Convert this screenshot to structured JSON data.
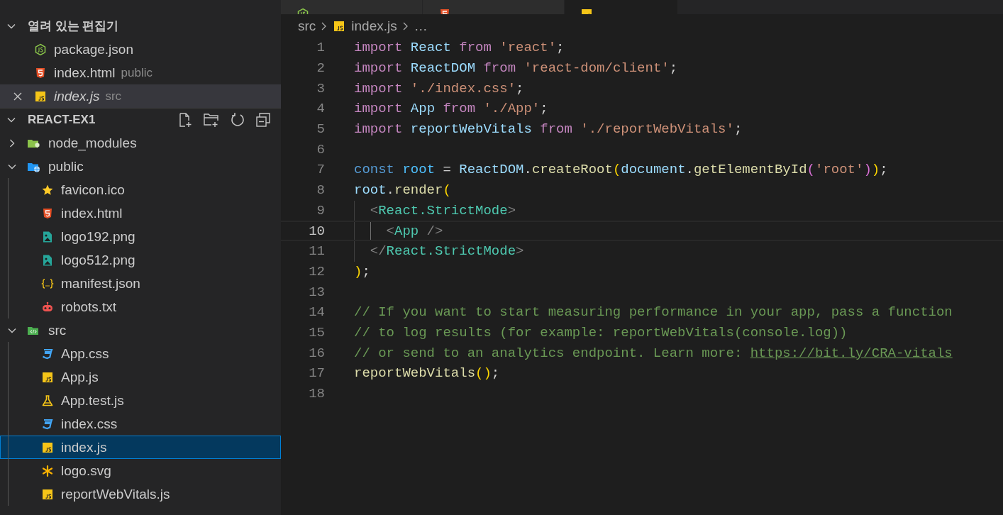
{
  "editor_tabs": [
    {
      "kind": "nodejs",
      "selected": false
    },
    {
      "kind": "html",
      "selected": false
    },
    {
      "kind": "js",
      "selected": true
    }
  ],
  "open_editors": {
    "title": "열려 있는 편집기",
    "expanded": true,
    "items": [
      {
        "name": "package.json",
        "kind": "nodejs",
        "selected": false,
        "preview": false
      },
      {
        "name": "index.html",
        "description": "public",
        "kind": "html",
        "selected": false,
        "preview": false
      },
      {
        "name": "index.js",
        "description": "src",
        "kind": "js",
        "selected": true,
        "preview": true
      }
    ]
  },
  "explorer": {
    "title": "REACT-EX1",
    "expanded": true,
    "tree": [
      {
        "name": "node_modules",
        "kind": "node-folder",
        "expanded": false,
        "selected": false
      },
      {
        "name": "public",
        "kind": "public-folder",
        "expanded": true,
        "selected": false,
        "children": [
          {
            "name": "favicon.ico",
            "kind": "star",
            "selected": false
          },
          {
            "name": "index.html",
            "kind": "html",
            "selected": false
          },
          {
            "name": "logo192.png",
            "kind": "image",
            "selected": false
          },
          {
            "name": "logo512.png",
            "kind": "image",
            "selected": false
          },
          {
            "name": "manifest.json",
            "kind": "braces",
            "selected": false
          },
          {
            "name": "robots.txt",
            "kind": "robot",
            "selected": false
          }
        ]
      },
      {
        "name": "src",
        "kind": "src-folder",
        "expanded": true,
        "selected": false,
        "children": [
          {
            "name": "App.css",
            "kind": "css",
            "selected": false
          },
          {
            "name": "App.js",
            "kind": "js",
            "selected": false
          },
          {
            "name": "App.test.js",
            "kind": "flask",
            "selected": false
          },
          {
            "name": "index.css",
            "kind": "css",
            "selected": false
          },
          {
            "name": "index.js",
            "kind": "js",
            "selected": true
          },
          {
            "name": "logo.svg",
            "kind": "asterisk",
            "selected": false
          },
          {
            "name": "reportWebVitals.js",
            "kind": "js",
            "selected": false
          }
        ]
      }
    ]
  },
  "breadcrumb": [
    {
      "text": "src",
      "kind": "folder"
    },
    {
      "text": "index.js",
      "kind": "js"
    },
    {
      "text": "…",
      "kind": "more"
    }
  ],
  "code": [
    {
      "number": "1",
      "current": false,
      "tokens": [
        {
          "t": "import ",
          "kind": "keyword"
        },
        {
          "t": "React ",
          "kind": "var"
        },
        {
          "t": "from ",
          "kind": "keyword"
        },
        {
          "t": "'react'",
          "kind": "string"
        },
        {
          "t": ";",
          "kind": "plain"
        }
      ]
    },
    {
      "number": "2",
      "current": false,
      "tokens": [
        {
          "t": "import ",
          "kind": "keyword"
        },
        {
          "t": "ReactDOM ",
          "kind": "var"
        },
        {
          "t": "from ",
          "kind": "keyword"
        },
        {
          "t": "'react-dom/client'",
          "kind": "string"
        },
        {
          "t": ";",
          "kind": "plain"
        }
      ]
    },
    {
      "number": "3",
      "current": false,
      "tokens": [
        {
          "t": "import ",
          "kind": "keyword"
        },
        {
          "t": "'./index.css'",
          "kind": "string"
        },
        {
          "t": ";",
          "kind": "plain"
        }
      ]
    },
    {
      "number": "4",
      "current": false,
      "tokens": [
        {
          "t": "import ",
          "kind": "keyword"
        },
        {
          "t": "App ",
          "kind": "var"
        },
        {
          "t": "from ",
          "kind": "keyword"
        },
        {
          "t": "'./App'",
          "kind": "string"
        },
        {
          "t": ";",
          "kind": "plain"
        }
      ]
    },
    {
      "number": "5",
      "current": false,
      "tokens": [
        {
          "t": "import ",
          "kind": "keyword"
        },
        {
          "t": "reportWebVitals ",
          "kind": "var"
        },
        {
          "t": "from ",
          "kind": "keyword"
        },
        {
          "t": "'./reportWebVitals'",
          "kind": "string"
        },
        {
          "t": ";",
          "kind": "plain"
        }
      ]
    },
    {
      "number": "6",
      "current": false
    },
    {
      "number": "7",
      "current": false,
      "tokens": [
        {
          "t": "const ",
          "kind": "storage"
        },
        {
          "t": "root ",
          "kind": "const"
        },
        {
          "t": "= ",
          "kind": "plain"
        },
        {
          "t": "ReactDOM",
          "kind": "var"
        },
        {
          "t": ".",
          "kind": "plain"
        },
        {
          "t": "createRoot",
          "kind": "func"
        },
        {
          "t": "(",
          "kind": "paren1"
        },
        {
          "t": "document",
          "kind": "var"
        },
        {
          "t": ".",
          "kind": "plain"
        },
        {
          "t": "getElementById",
          "kind": "func"
        },
        {
          "t": "(",
          "kind": "paren2"
        },
        {
          "t": "'root'",
          "kind": "string"
        },
        {
          "t": ")",
          "kind": "paren2"
        },
        {
          "t": ")",
          "kind": "paren1"
        },
        {
          "t": ";",
          "kind": "plain"
        }
      ]
    },
    {
      "number": "8",
      "current": false,
      "tokens": [
        {
          "t": "root",
          "kind": "var"
        },
        {
          "t": ".",
          "kind": "plain"
        },
        {
          "t": "render",
          "kind": "func"
        },
        {
          "t": "(",
          "kind": "paren1"
        }
      ]
    },
    {
      "number": "9",
      "current": false,
      "guides": [
        {
          "active": false
        }
      ],
      "tokens": [
        {
          "t": "<",
          "kind": "angle"
        },
        {
          "t": "React.StrictMode",
          "kind": "tag"
        },
        {
          "t": ">",
          "kind": "angle"
        }
      ]
    },
    {
      "number": "10",
      "current": true,
      "guides": [
        {
          "active": false
        },
        {
          "active": true
        }
      ],
      "tokens": [
        {
          "t": "<",
          "kind": "angle"
        },
        {
          "t": "App ",
          "kind": "tag"
        },
        {
          "t": "/>",
          "kind": "angle"
        }
      ]
    },
    {
      "number": "11",
      "current": false,
      "guides": [
        {
          "active": false
        }
      ],
      "tokens": [
        {
          "t": "</",
          "kind": "angle"
        },
        {
          "t": "React.StrictMode",
          "kind": "tag"
        },
        {
          "t": ">",
          "kind": "angle"
        }
      ]
    },
    {
      "number": "12",
      "current": false,
      "tokens": [
        {
          "t": ")",
          "kind": "paren1"
        },
        {
          "t": ";",
          "kind": "plain"
        }
      ]
    },
    {
      "number": "13",
      "current": false
    },
    {
      "number": "14",
      "current": false,
      "tokens": [
        {
          "t": "// If you want to start measuring performance in your app, pass a function",
          "kind": "comment"
        }
      ]
    },
    {
      "number": "15",
      "current": false,
      "tokens": [
        {
          "t": "// to log results (for example: reportWebVitals(console.log))",
          "kind": "comment"
        }
      ]
    },
    {
      "number": "16",
      "current": false,
      "tokens": [
        {
          "t": "// or send to an analytics endpoint. Learn more: ",
          "kind": "comment"
        },
        {
          "t": "https://bit.ly/CRA-vitals",
          "kind": "link"
        }
      ]
    },
    {
      "number": "17",
      "current": false,
      "tokens": [
        {
          "t": "reportWebVitals",
          "kind": "func"
        },
        {
          "t": "(",
          "kind": "paren1"
        },
        {
          "t": ")",
          "kind": "paren1"
        },
        {
          "t": ";",
          "kind": "plain"
        }
      ]
    },
    {
      "number": "18",
      "current": false
    }
  ]
}
